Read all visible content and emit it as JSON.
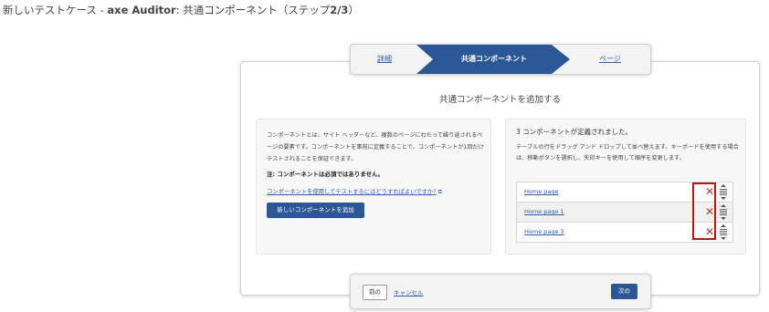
{
  "page_title": {
    "prefix": "新しいテストケース - ",
    "app": "axe Auditor",
    "suffix": ": 共通コンポーネント（ステップ",
    "step": "2/3",
    "close": "）"
  },
  "stepper": {
    "steps": [
      {
        "label": "詳細",
        "state": "link"
      },
      {
        "label": "共通コンポーネント",
        "state": "active"
      },
      {
        "label": "ページ",
        "state": "link"
      }
    ],
    "active_color": "#2b5797"
  },
  "section_title": "共通コンポーネントを追加する",
  "left_panel": {
    "description": "コンポーネントとは、サイト ヘッダーなど、複数のページにわたって繰り返されるページの要素です。コンポーネントを事前に定義することで、コンポーネントが1回だけテストされることを保証できます。",
    "note": "注: コンポーネントは必須ではありません。",
    "help_link": "コンポーネントを使用してテストするにはどうすればよいですか?",
    "add_button": "新しいコンポーネントを追加"
  },
  "right_panel": {
    "count_text": "3 コンポーネントが定義されました。",
    "instructions": "テーブルの行をドラッグ アンド ドロップして並べ替えます。キーボードを使用する場合は、移動ボタンを選択し、矢印キーを使用して順序を変更します。",
    "components": [
      {
        "name": "Home page"
      },
      {
        "name": "Home page 1"
      },
      {
        "name": "Home page 3"
      }
    ]
  },
  "footer": {
    "prev_label": "前の",
    "cancel_label": "キャンセル",
    "next_label": "次の"
  },
  "colors": {
    "primary": "#2b5797",
    "link": "#2e5ea3",
    "delete": "#c0392b",
    "highlight": "#d01010"
  }
}
